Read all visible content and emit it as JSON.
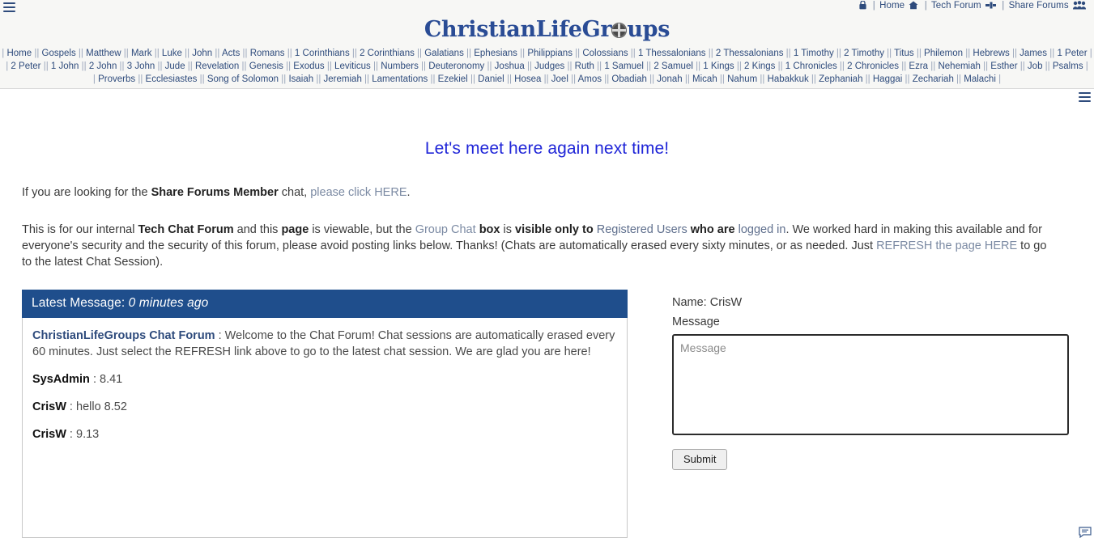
{
  "topbar": {
    "lock_icon": "lock-icon",
    "home_label": "Home",
    "home_icon": "home-icon",
    "tech_forum_label": "Tech Forum",
    "tech_forum_icon": "tools-icon",
    "share_forums_label": "Share Forums",
    "share_forums_icon": "people-icon",
    "separator": "|",
    "menu_icon": "hamburger-menu-icon"
  },
  "logo": {
    "part1": "ChristianLifeGr",
    "compass_icon": "compass-icon",
    "part2": "ups"
  },
  "booknav": {
    "rows": [
      [
        "Home",
        "Gospels",
        "Matthew",
        "Mark",
        "Luke",
        "John",
        "Acts",
        "Romans",
        "1 Corinthians",
        "2 Corinthians",
        "Galatians",
        "Ephesians",
        "Philippians",
        "Colossians",
        "1 Thessalonians",
        "2 Thessalonians",
        "1 Timothy",
        "2 Timothy",
        "Titus",
        "Philemon",
        "Hebrews",
        "James",
        "1 Peter"
      ],
      [
        "2 Peter",
        "1 John",
        "2 John",
        "3 John",
        "Jude",
        "Revelation",
        "Genesis",
        "Exodus",
        "Leviticus",
        "Numbers",
        "Deuteronomy",
        "Joshua",
        "Judges",
        "Ruth",
        "1 Samuel",
        "2 Samuel",
        "1 Kings",
        "2 Kings",
        "1 Chronicles",
        "2 Chronicles",
        "Ezra",
        "Nehemiah",
        "Esther",
        "Job",
        "Psalms"
      ],
      [
        "Proverbs",
        "Ecclesiastes",
        "Song of Solomon",
        "Isaiah",
        "Jeremiah",
        "Lamentations",
        "Ezekiel",
        "Daniel",
        "Hosea",
        "Joel",
        "Amos",
        "Obadiah",
        "Jonah",
        "Micah",
        "Nahum",
        "Habakkuk",
        "Zephaniah",
        "Haggai",
        "Zechariah",
        "Malachi"
      ]
    ]
  },
  "main": {
    "title": "Let's meet here again next time!",
    "paragraph1": {
      "t1": "If you are looking for the ",
      "b1": "Share Forums Member",
      "t2": " chat, ",
      "link1": "please click HERE",
      "t3": "."
    },
    "paragraph2": {
      "t1": "This is for our internal ",
      "b1": "Tech Chat Forum",
      "t2": " and this ",
      "b2": "page",
      "t3": " is viewable, but the ",
      "link1": "Group Chat",
      "t4": " ",
      "b3": "box",
      "t5": " is ",
      "b4": "visible only to",
      "t6": " ",
      "link2": "Registered Users",
      "t7": " ",
      "b5": "who are",
      "t8": " ",
      "link3": "logged in",
      "t9": ". We worked hard in making this available and for everyone's security and the security of this forum, please avoid posting links below.  Thanks! (Chats are automatically erased every sixty minutes, or as needed. Just ",
      "link4": "REFRESH the page HERE",
      "t10": " to go to the latest Chat Session)."
    }
  },
  "chat": {
    "header_label": "Latest Message:",
    "header_relative_time": "0 minutes ago",
    "messages": [
      {
        "author": "ChristianLifeGroups Chat Forum",
        "author_style": "link",
        "sep": " : ",
        "text": "Welcome to the Chat Forum! Chat sessions are automatically erased every 60 minutes. Just select the REFRESH link above to go to the latest chat session. We are glad you are here!"
      },
      {
        "author": "SysAdmin",
        "author_style": "dark",
        "sep": " : ",
        "text": "8.41"
      },
      {
        "author": "CrisW",
        "author_style": "dark",
        "sep": " : ",
        "text": "hello 8.52"
      },
      {
        "author": "CrisW",
        "author_style": "dark",
        "sep": " : ",
        "text": "9.13"
      }
    ]
  },
  "form": {
    "name_label": "Name: CrisW",
    "message_label": "Message",
    "message_value": "",
    "message_placeholder": "Message",
    "submit_label": "Submit",
    "chat_bubble_icon": "chat-bubble-icon"
  },
  "colors": {
    "brand_blue": "#2a4c95",
    "header_blue": "#1f4e8c",
    "title_blue": "#2026d8",
    "nav_blue": "#2e4b7c",
    "page_bg": "#ffffff",
    "topbar_bg": "#f7f7f5"
  }
}
